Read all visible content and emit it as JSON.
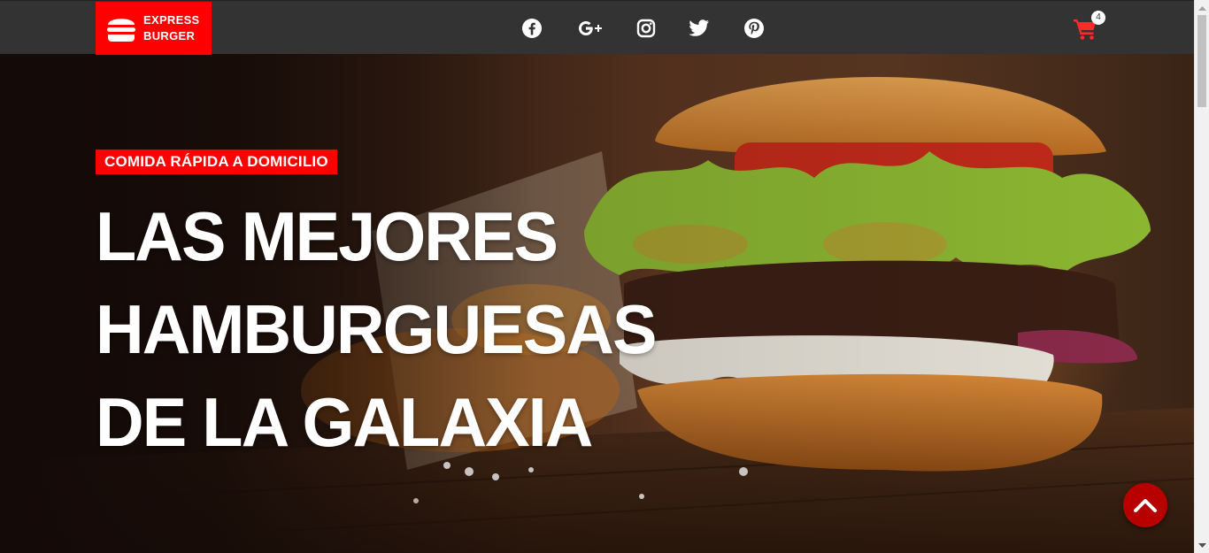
{
  "brand": {
    "line1": "EXPRESS",
    "line2": "BURGER",
    "icon": "burger-icon"
  },
  "social": [
    {
      "name": "facebook-icon"
    },
    {
      "name": "google-plus-icon"
    },
    {
      "name": "instagram-icon"
    },
    {
      "name": "twitter-icon"
    },
    {
      "name": "pinterest-icon"
    }
  ],
  "cart": {
    "icon": "shopping-cart-icon",
    "count": "4"
  },
  "hero": {
    "tagline": "COMIDA RÁPIDA A DOMICILIO",
    "headline_lines": [
      "LAS MEJORES",
      "HAMBURGUESAS",
      "DE LA GALAXIA"
    ]
  },
  "scroll_top": {
    "icon": "chevron-up-icon"
  },
  "colors": {
    "accent": "#ff0000",
    "header_bg": "#333333",
    "scroll_top_bg": "#b80000",
    "cart_icon": "#ff2a2a"
  }
}
